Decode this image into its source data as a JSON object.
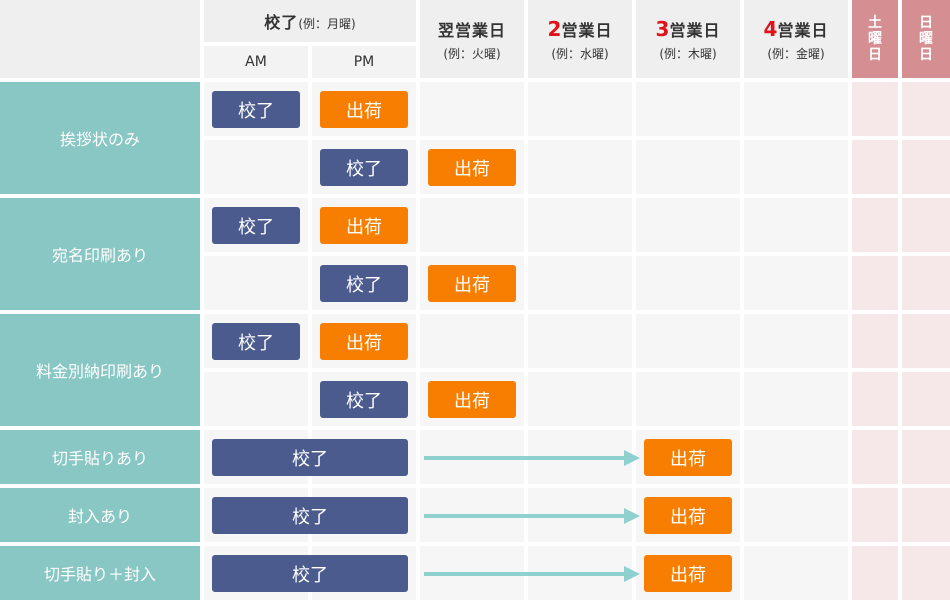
{
  "header": {
    "kouryou": "校了",
    "kouryou_example": "(例：月曜)",
    "am": "AM",
    "pm": "PM",
    "days": [
      {
        "num": "",
        "label": "翌営業日",
        "example": "(例：火曜)"
      },
      {
        "num": "2",
        "label": "営業日",
        "example": "(例：水曜)"
      },
      {
        "num": "3",
        "label": "営業日",
        "example": "(例：木曜)"
      },
      {
        "num": "4",
        "label": "営業日",
        "example": "(例：金曜)"
      }
    ],
    "saturday": "土曜日",
    "sunday": "日曜日"
  },
  "rows": [
    {
      "label": "挨拶状のみ"
    },
    {
      "label": "宛名印刷あり"
    },
    {
      "label": "料金別納印刷あり"
    },
    {
      "label": "切手貼りあり"
    },
    {
      "label": "封入あり"
    },
    {
      "label": "切手貼り＋封入"
    }
  ],
  "badges": {
    "kouryou": "校了",
    "shukka": "出荷"
  },
  "colors": {
    "navy": "#4b5b8e",
    "orange": "#f77e00",
    "teal": "#88c7c4",
    "weekend": "#d58e92",
    "number_red": "#e1131a"
  }
}
